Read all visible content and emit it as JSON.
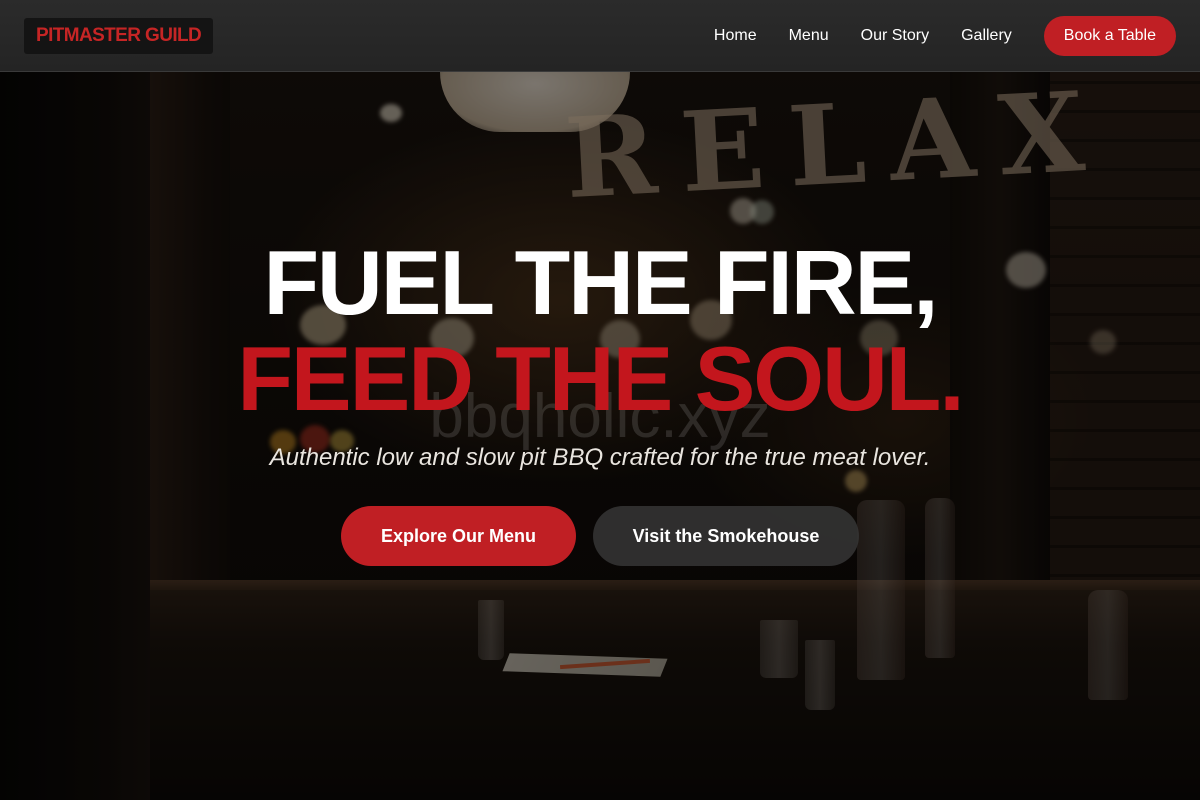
{
  "header": {
    "logo_text": "PITMASTER GUILD",
    "nav": [
      {
        "label": "Home"
      },
      {
        "label": "Menu"
      },
      {
        "label": "Our Story"
      },
      {
        "label": "Gallery"
      }
    ],
    "book_button": "Book a Table"
  },
  "hero": {
    "background_sign": "RELAX",
    "headline_line1": "FUEL THE FIRE,",
    "headline_line2": "FEED THE SOUL.",
    "watermark": "bbqholic.xyz",
    "tagline": "Authentic low and slow pit BBQ crafted for the true meat lover.",
    "primary_cta": "Explore Our Menu",
    "secondary_cta": "Visit the Smokehouse"
  },
  "colors": {
    "accent_red": "#c01f24",
    "headline_red": "#c3161d",
    "header_bg": "#262626",
    "secondary_button": "#343434"
  }
}
